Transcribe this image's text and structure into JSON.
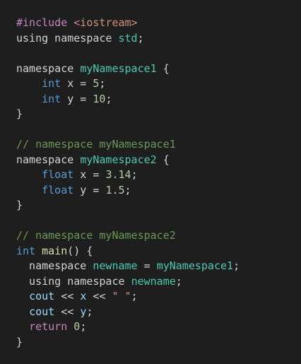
{
  "editor": {
    "theme": {
      "background": "#1e1e1e",
      "plain": "#d4d4d4",
      "keyword": "#569cd6",
      "typename": "#4ec9b0",
      "number": "#b5cea8",
      "string": "#ce9178",
      "comment": "#6a9955",
      "function": "#dcdcaa",
      "variable": "#9cdcfe",
      "preprocessor": "#c586c0"
    },
    "lines": [
      [
        {
          "t": "#include ",
          "c": "preproc"
        },
        {
          "t": "<iostream>",
          "c": "include"
        }
      ],
      [
        {
          "t": "using namespace ",
          "c": "plain"
        },
        {
          "t": "std",
          "c": "typename"
        },
        {
          "t": ";",
          "c": "plain"
        }
      ],
      [],
      [
        {
          "t": "namespace ",
          "c": "plain"
        },
        {
          "t": "myNamespace1",
          "c": "typename"
        },
        {
          "t": " {",
          "c": "plain"
        }
      ],
      [
        {
          "t": "    ",
          "c": "plain"
        },
        {
          "t": "int",
          "c": "type"
        },
        {
          "t": " x = ",
          "c": "plain"
        },
        {
          "t": "5",
          "c": "number"
        },
        {
          "t": ";",
          "c": "plain"
        }
      ],
      [
        {
          "t": "    ",
          "c": "plain"
        },
        {
          "t": "int",
          "c": "type"
        },
        {
          "t": " y = ",
          "c": "plain"
        },
        {
          "t": "10",
          "c": "number"
        },
        {
          "t": ";",
          "c": "plain"
        }
      ],
      [
        {
          "t": "}",
          "c": "plain"
        }
      ],
      [],
      [
        {
          "t": "// namespace myNamespace1",
          "c": "comment"
        }
      ],
      [
        {
          "t": "namespace ",
          "c": "plain"
        },
        {
          "t": "myNamespace2",
          "c": "typename"
        },
        {
          "t": " {",
          "c": "plain"
        }
      ],
      [
        {
          "t": "    ",
          "c": "plain"
        },
        {
          "t": "float",
          "c": "type"
        },
        {
          "t": " x = ",
          "c": "plain"
        },
        {
          "t": "3.14",
          "c": "number"
        },
        {
          "t": ";",
          "c": "plain"
        }
      ],
      [
        {
          "t": "    ",
          "c": "plain"
        },
        {
          "t": "float",
          "c": "type"
        },
        {
          "t": " y = ",
          "c": "plain"
        },
        {
          "t": "1.5",
          "c": "number"
        },
        {
          "t": ";",
          "c": "plain"
        }
      ],
      [
        {
          "t": "}",
          "c": "plain"
        }
      ],
      [],
      [
        {
          "t": "// namespace myNamespace2",
          "c": "comment"
        }
      ],
      [
        {
          "t": "int",
          "c": "type"
        },
        {
          "t": " ",
          "c": "plain"
        },
        {
          "t": "main",
          "c": "func"
        },
        {
          "t": "() {",
          "c": "plain"
        }
      ],
      [
        {
          "t": "  namespace ",
          "c": "plain"
        },
        {
          "t": "newname",
          "c": "typename"
        },
        {
          "t": " = ",
          "c": "plain"
        },
        {
          "t": "myNamespace1",
          "c": "typename"
        },
        {
          "t": ";",
          "c": "plain"
        }
      ],
      [
        {
          "t": "  using namespace ",
          "c": "plain"
        },
        {
          "t": "newname",
          "c": "typename"
        },
        {
          "t": ";",
          "c": "plain"
        }
      ],
      [
        {
          "t": "  ",
          "c": "plain"
        },
        {
          "t": "cout",
          "c": "var"
        },
        {
          "t": " << ",
          "c": "plain"
        },
        {
          "t": "x",
          "c": "var"
        },
        {
          "t": " << ",
          "c": "plain"
        },
        {
          "t": "\" \"",
          "c": "string"
        },
        {
          "t": ";",
          "c": "plain"
        }
      ],
      [
        {
          "t": "  ",
          "c": "plain"
        },
        {
          "t": "cout",
          "c": "var"
        },
        {
          "t": " << ",
          "c": "plain"
        },
        {
          "t": "y",
          "c": "var"
        },
        {
          "t": ";",
          "c": "plain"
        }
      ],
      [
        {
          "t": "  ",
          "c": "plain"
        },
        {
          "t": "return",
          "c": "control"
        },
        {
          "t": " ",
          "c": "plain"
        },
        {
          "t": "0",
          "c": "number"
        },
        {
          "t": ";",
          "c": "plain"
        }
      ],
      [
        {
          "t": "}",
          "c": "plain"
        }
      ]
    ]
  }
}
